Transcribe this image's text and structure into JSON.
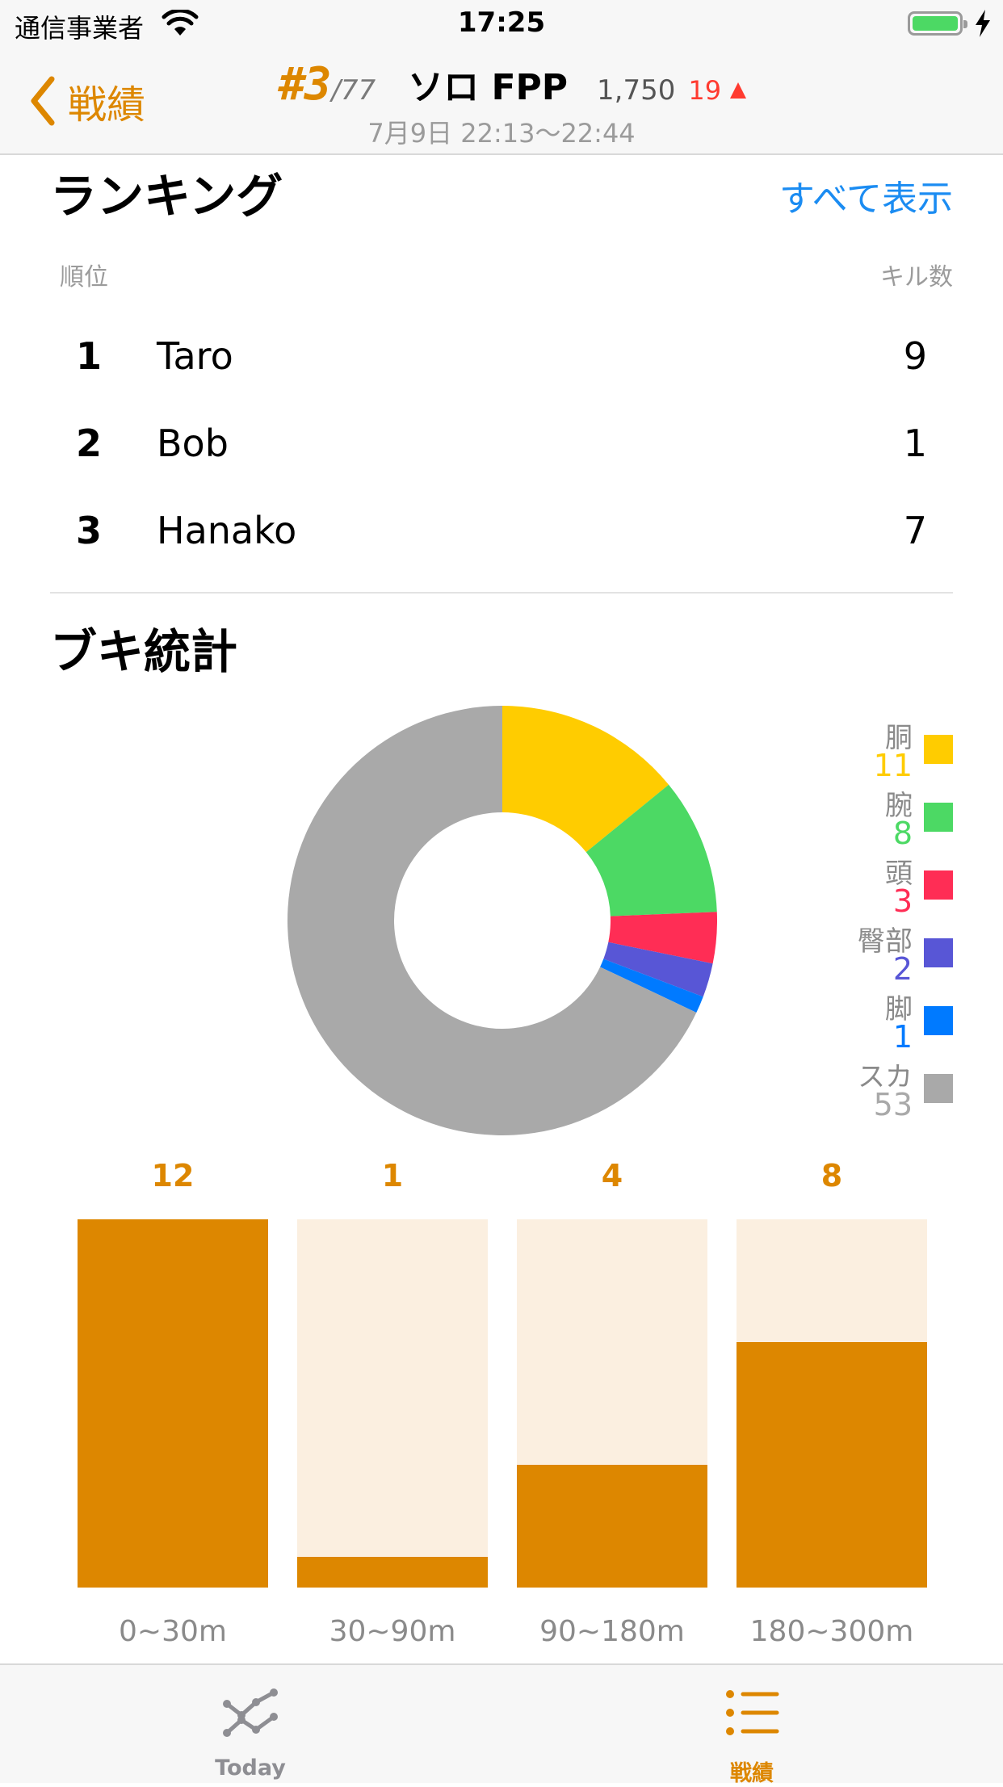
{
  "status_bar": {
    "carrier": "通信事業者",
    "time": "17:25"
  },
  "nav": {
    "back_label": "戦績",
    "rank": "#3",
    "rank_total": "/77",
    "mode": "ソロ FPP",
    "rating": "1,750",
    "rating_delta": "19",
    "date": "7月9日 22:13〜22:44"
  },
  "ranking": {
    "title": "ランキング",
    "show_all": "すべて表示",
    "col_rank": "順位",
    "col_kills": "キル数",
    "rows": [
      {
        "rank": "1",
        "name": "Taro",
        "kills": "9"
      },
      {
        "rank": "2",
        "name": "Bob",
        "kills": "1"
      },
      {
        "rank": "3",
        "name": "Hanako",
        "kills": "7"
      }
    ]
  },
  "weapon_stats": {
    "title": "ブキ統計"
  },
  "chart_data": [
    {
      "type": "pie",
      "donut": true,
      "legend": "right",
      "slices": [
        {
          "label": "胴",
          "value": 11,
          "color": "#ffcc00"
        },
        {
          "label": "腕",
          "value": 8,
          "color": "#4cd964"
        },
        {
          "label": "頭",
          "value": 3,
          "color": "#ff2d55"
        },
        {
          "label": "臀部",
          "value": 2,
          "color": "#5856d6"
        },
        {
          "label": "脚",
          "value": 1,
          "color": "#007aff"
        },
        {
          "label": "スカ",
          "value": 53,
          "color": "#a9a9a9"
        }
      ]
    },
    {
      "type": "bar",
      "categories": [
        "0~30m",
        "30~90m",
        "90~180m",
        "180~300m"
      ],
      "values": [
        12,
        1,
        4,
        8
      ],
      "ylim": [
        0,
        12
      ],
      "colors": {
        "fill": "#dd8700",
        "track": "#fbefe0"
      }
    }
  ],
  "tabs": [
    {
      "label": "Today",
      "active": false
    },
    {
      "label": "戦績",
      "active": true
    }
  ],
  "colors": {
    "accent": "#dd8700",
    "link": "#1b8cf2",
    "delta": "#ff3b30",
    "inactive": "#8e8e93"
  }
}
